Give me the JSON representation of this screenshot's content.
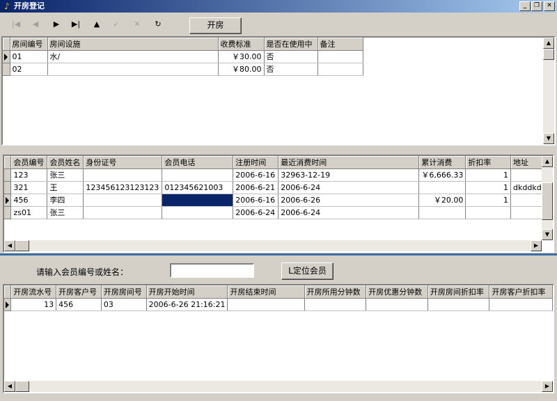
{
  "window": {
    "title": "开房登记",
    "min": "_",
    "restore": "❐",
    "close": "✕"
  },
  "toolbar": {
    "nav": [
      {
        "name": "first-record-icon",
        "glyph": "|◀",
        "enabled": false
      },
      {
        "name": "prior-record-icon",
        "glyph": "◀",
        "enabled": false
      },
      {
        "name": "next-record-icon",
        "glyph": "▶",
        "enabled": true
      },
      {
        "name": "last-record-icon",
        "glyph": "▶|",
        "enabled": true
      },
      {
        "name": "insert-record-icon",
        "glyph": "▲",
        "enabled": true
      },
      {
        "name": "post-record-icon",
        "glyph": "✓",
        "enabled": false
      },
      {
        "name": "cancel-record-icon",
        "glyph": "✕",
        "enabled": false
      },
      {
        "name": "refresh-icon",
        "glyph": "↻",
        "enabled": true
      }
    ],
    "open_room_label": "开房"
  },
  "rooms": {
    "columns": [
      "房间编号",
      "房间设施",
      "收费标准",
      "是否在使用中",
      "备注"
    ],
    "rows": [
      [
        "01",
        "水/",
        "￥30.00",
        "否",
        ""
      ],
      [
        "02",
        "",
        "￥80.00",
        "否",
        ""
      ]
    ]
  },
  "members": {
    "columns": [
      "会员编号",
      "会员姓名",
      "身份证号",
      "会员电话",
      "注册时间",
      "最近消费时间",
      "累计消费",
      "折扣率",
      "地址"
    ],
    "rows": [
      [
        "123",
        "张三",
        "",
        "",
        "2006-6-16",
        "32963-12-19",
        "￥6,666.33",
        "1",
        ""
      ],
      [
        "321",
        "王",
        "123456123123123",
        "012345621003",
        "2006-6-21",
        "2006-6-24",
        "",
        "1",
        "dkddkdk"
      ],
      [
        "456",
        "李四",
        "",
        "",
        "2006-6-16",
        "2006-6-26",
        "￥20.00",
        "1",
        ""
      ],
      [
        "zs01",
        "张三",
        "",
        "",
        "2006-6-24",
        "2006-6-24",
        "",
        "",
        ""
      ]
    ],
    "current_row": 2
  },
  "search": {
    "prompt": "请输入会员编号或姓名：",
    "value": "",
    "locate_label": "L定位会员"
  },
  "openings": {
    "columns": [
      "开房流水号",
      "开房客户号",
      "开房房间号",
      "开房开始时间",
      "开房结束时间",
      "开房所用分钟数",
      "开房优惠分钟数",
      "开房房间折扣率",
      "开房客户折扣率"
    ],
    "rows": [
      [
        "13",
        "456",
        "03",
        "2006-6-26 21:16:21",
        "",
        "",
        "",
        "",
        ""
      ]
    ]
  }
}
